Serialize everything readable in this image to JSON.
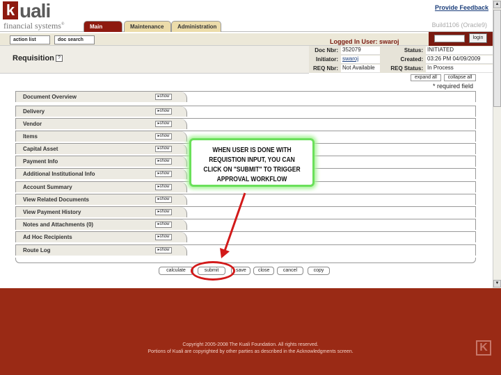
{
  "header": {
    "logo_letter": "k",
    "logo_word": "uali",
    "logo_tagline": "financial systems",
    "provide_feedback": "Provide Feedback",
    "build": "Build1106 (Oracle9)",
    "tabs": [
      "Main Menu",
      "Maintenance",
      "Administration"
    ],
    "login_button": "login"
  },
  "toolbar": {
    "action_list": "action list",
    "doc_search": "doc search",
    "logged_in": "Logged In User: swaroj"
  },
  "page": {
    "title": "Requisition",
    "help": "?"
  },
  "doc_info": {
    "doc_nbr_label": "Doc Nbr:",
    "doc_nbr": "352079",
    "status_label": "Status:",
    "status": "INITIATED",
    "initiator_label": "Initiator:",
    "initiator": "swaroj",
    "created_label": "Created:",
    "created": "03:26 PM 04/09/2009",
    "req_nbr_label": "REQ Nbr:",
    "req_nbr": "Not Available",
    "req_status_label": "REQ Status:",
    "req_status": "In Process"
  },
  "controls": {
    "expand_all": "expand all",
    "collapse_all": "collapse all",
    "required_note": "* required field"
  },
  "sections": [
    {
      "label": "Document Overview",
      "show": "show"
    },
    {
      "label": "Delivery",
      "show": "show"
    },
    {
      "label": "Vendor",
      "show": "show"
    },
    {
      "label": "Items",
      "show": "show"
    },
    {
      "label": "Capital Asset",
      "show": "show"
    },
    {
      "label": "Payment Info",
      "show": "show"
    },
    {
      "label": "Additional Institutional Info",
      "show": "show"
    },
    {
      "label": "Account Summary",
      "show": "show"
    },
    {
      "label": "View Related Documents",
      "show": "show"
    },
    {
      "label": "View Payment History",
      "show": "show"
    },
    {
      "label": "Notes and Attachments (0)",
      "show": "show"
    },
    {
      "label": "Ad Hoc Recipients",
      "show": "show"
    },
    {
      "label": "Route Log",
      "show": "show"
    }
  ],
  "footer_buttons": [
    "calculate",
    "submit",
    "save",
    "close",
    "cancel",
    "copy"
  ],
  "callout": {
    "lines": [
      "WHEN USER IS DONE WITH",
      "REQUISTION INPUT, YOU CAN",
      "CLICK ON \"SUBMIT\" TO TRIGGER",
      "APPROVAL WORKFLOW"
    ]
  },
  "footer": {
    "copyright": "Copyright 2005-2008 The Kuali Foundation. All rights reserved.",
    "trademark": "Portions of Kuali are copyrighted by other parties as described in the Acknowledgments screen.",
    "logo": "K"
  },
  "colors": {
    "brand": "#8e1a10",
    "callout_border": "#6ae05a",
    "highlight": "#d21a1a"
  }
}
